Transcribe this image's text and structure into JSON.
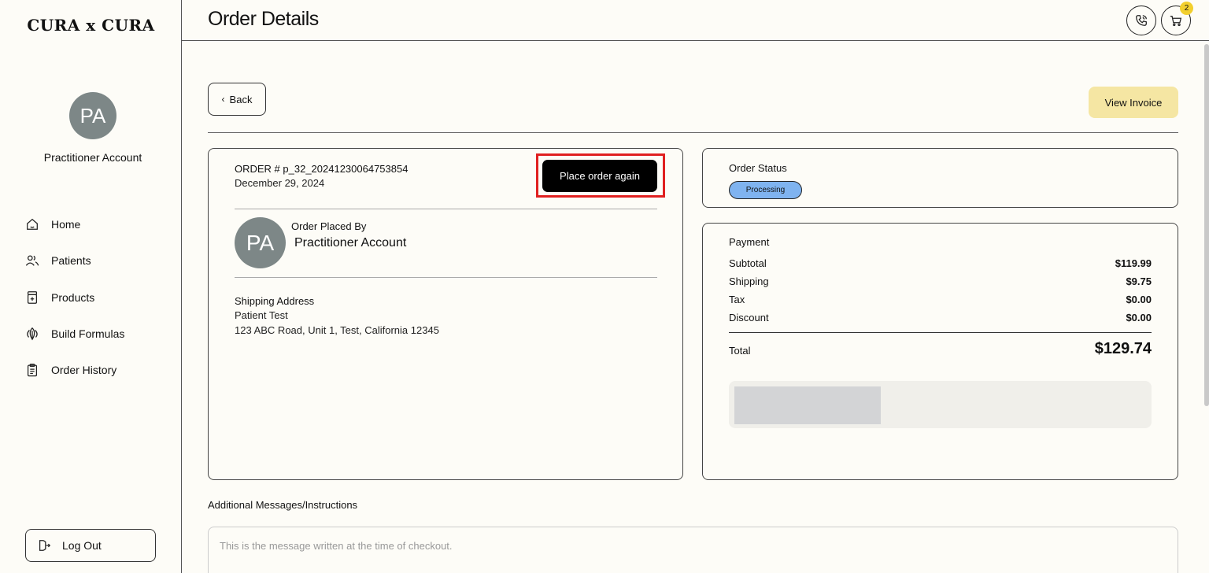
{
  "sidebar": {
    "brand": "CURA x CURA",
    "avatar_initials": "PA",
    "account_name": "Practitioner Account",
    "nav": [
      {
        "label": "Home",
        "icon": "home-icon"
      },
      {
        "label": "Patients",
        "icon": "users-icon"
      },
      {
        "label": "Products",
        "icon": "product-icon"
      },
      {
        "label": "Build Formulas",
        "icon": "formula-icon"
      },
      {
        "label": "Order History",
        "icon": "clipboard-icon"
      }
    ],
    "logout_label": "Log Out"
  },
  "header": {
    "title": "Order Details",
    "cart_count": "2"
  },
  "actions": {
    "back_label": "Back",
    "view_invoice_label": "View Invoice"
  },
  "order": {
    "number": "ORDER # p_32_20241230064753854",
    "date": "December 29, 2024",
    "reorder_label": "Place order again",
    "placed_by_label": "Order Placed By",
    "placed_by_initials": "PA",
    "placed_by_name": "Practitioner Account",
    "shipping_label": "Shipping Address",
    "shipping_name": "Patient Test",
    "shipping_address": "123 ABC Road, Unit 1, Test, California 12345"
  },
  "status": {
    "label": "Order Status",
    "value": "Processing",
    "color": "#7fb3f0"
  },
  "payment": {
    "title": "Payment",
    "rows": [
      {
        "label": "Subtotal",
        "value": "$119.99"
      },
      {
        "label": "Shipping",
        "value": "$9.75"
      },
      {
        "label": "Tax",
        "value": "$0.00"
      },
      {
        "label": "Discount",
        "value": "$0.00"
      }
    ],
    "total_label": "Total",
    "total_value": "$129.74"
  },
  "messages": {
    "label": "Additional Messages/Instructions",
    "text": "This is the message written at the time of checkout."
  }
}
